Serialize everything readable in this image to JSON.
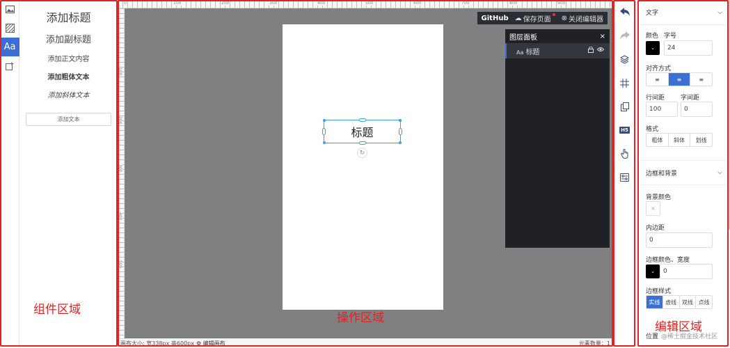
{
  "left_icons": [
    "image-icon",
    "texture-icon",
    "text-icon",
    "add-box-icon"
  ],
  "text_icon_label": "Aa",
  "components": {
    "heading": "添加标题",
    "subheading": "添加副标题",
    "body": "添加正文内容",
    "bold": "添加粗体文本",
    "italic": "添加斜体文本",
    "add_text": "添加文本"
  },
  "regions": {
    "components": "组件区域",
    "operation": "操作区域",
    "editor": "编辑区域"
  },
  "ruler": {
    "top": [
      "0",
      "100",
      "200",
      "300",
      "400",
      "500",
      "600",
      "700",
      "800",
      "900"
    ],
    "left": [
      "100",
      "200",
      "300",
      "400",
      "500"
    ]
  },
  "top_actions": {
    "github": "GitHub",
    "save": "保存页面",
    "close": "关闭编辑器"
  },
  "canvas": {
    "selected_text": "标题"
  },
  "layer_panel": {
    "title": "图层面板",
    "close": "×",
    "item_icon": "Aa",
    "item_label": "标题"
  },
  "status": {
    "canvas_size": "画布大小: 宽338px 高600px",
    "edit_canvas": "编辑画布",
    "element_count": "元素数量：1"
  },
  "editor": {
    "text_section": "文字",
    "color_label": "颜色",
    "size_label": "字号",
    "size_value": "24",
    "align_label": "对齐方式",
    "line_height_label": "行间距",
    "line_height_value": "100",
    "letter_spacing_label": "字间距",
    "letter_spacing_value": "0",
    "style_label": "格式",
    "styles": [
      "粗体",
      "斜体",
      "划线"
    ],
    "border_section": "边框和背景",
    "bg_color_label": "背景颜色",
    "padding_label": "内边距",
    "padding_value": "0",
    "border_color_width_label": "边框颜色、宽度",
    "border_width_value": "0",
    "border_style_label": "边框样式",
    "border_styles": [
      "实线",
      "虚线",
      "双线",
      "点线"
    ],
    "position_label": "位置",
    "watermark": "@稀土掘金技术社区"
  },
  "colors": {
    "accent": "#3c6fd6",
    "region_outline": "#e02424",
    "canvas_bg": "#808080",
    "selection": "#3aa0e0"
  }
}
